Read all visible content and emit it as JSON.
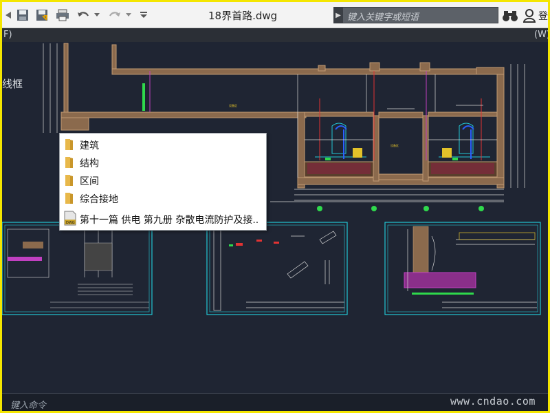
{
  "window": {
    "title": "18界首路.dwg",
    "search_placeholder": "键入关键字或短语",
    "login_label": "登",
    "ribbon_left": "F)",
    "ribbon_right": "(W)"
  },
  "quick_access": [
    {
      "name": "share-icon"
    },
    {
      "name": "save-icon"
    },
    {
      "name": "save-as-icon"
    },
    {
      "name": "print-icon"
    },
    {
      "name": "undo-icon"
    },
    {
      "name": "redo-icon"
    },
    {
      "name": "customize-dropdown-icon"
    }
  ],
  "canvas": {
    "side_label": "线框"
  },
  "context_menu": {
    "items": [
      {
        "label": "建筑",
        "icon": "folder-icon"
      },
      {
        "label": "结构",
        "icon": "folder-icon"
      },
      {
        "label": "区间",
        "icon": "folder-icon"
      },
      {
        "label": "综合接地",
        "icon": "folder-icon"
      },
      {
        "label": "第十一篇 供电 第九册 杂散电流防护及接..",
        "icon": "dwg-file-icon"
      }
    ]
  },
  "command_line": {
    "prompt": "键入命令"
  },
  "watermark": "www.cndao.com",
  "colors": {
    "border": "#f4e600",
    "canvas_bg": "#1f2533",
    "cad_brown": "#b8916b",
    "cad_cyan": "#22c8d6",
    "cad_magenta": "#c040c0",
    "cad_green": "#2fd94c",
    "cad_yellow": "#e2c22a",
    "cad_blue": "#2a60ff",
    "cad_red": "#e23333"
  }
}
